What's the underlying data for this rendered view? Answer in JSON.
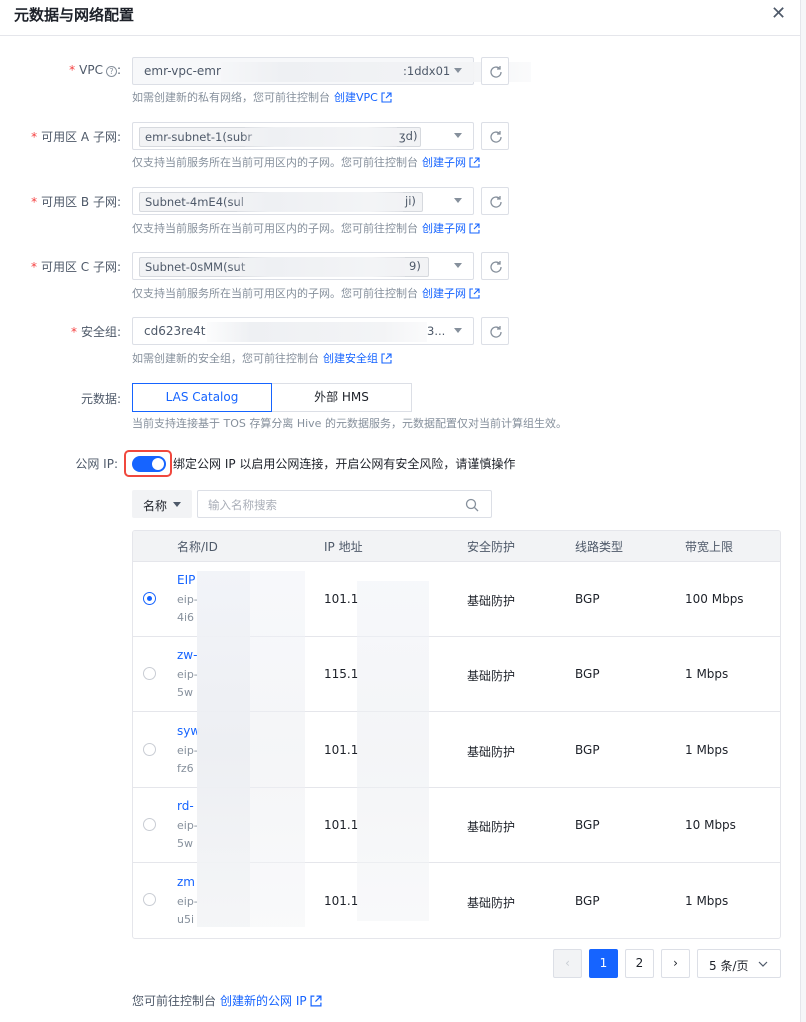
{
  "dialog": {
    "title": "元数据与网络配置",
    "close_glyph": "✕"
  },
  "vpc": {
    "label": "VPC",
    "required_mark": "*",
    "value_prefix": "emr-vpc-emr",
    "value_suffix": ":1ddx01",
    "hint": "如需创建新的私有网络，您可前往控制台",
    "link": "创建VPC"
  },
  "subnet_a": {
    "label": "可用区 A 子网:",
    "required_mark": "*",
    "value_prefix": "emr-subnet-1(subr",
    "value_suffix": "ʒd)",
    "hint": "仅支持当前服务所在当前可用区内的子网。您可前往控制台",
    "link": "创建子网"
  },
  "subnet_b": {
    "label": "可用区 B 子网:",
    "required_mark": "*",
    "value_prefix": "Subnet-4mE4(sul",
    "value_suffix": "ji)",
    "hint": "仅支持当前服务所在当前可用区内的子网。您可前往控制台",
    "link": "创建子网"
  },
  "subnet_c": {
    "label": "可用区 C 子网:",
    "required_mark": "*",
    "value_prefix": "Subnet-0sMM(sut",
    "value_suffix": "9)",
    "hint": "仅支持当前服务所在当前可用区内的子网。您可前往控制台",
    "link": "创建子网"
  },
  "security_group": {
    "label": "安全组:",
    "required_mark": "*",
    "value_prefix": "cd623re4t",
    "value_suffix": "3...",
    "hint": "如需创建新的安全组，您可前往控制台",
    "link": "创建安全组"
  },
  "metadata": {
    "label": "元数据:",
    "options": [
      "LAS Catalog",
      "外部 HMS"
    ],
    "selected": "LAS Catalog",
    "hint": "当前支持连接基于 TOS 存算分离 Hive 的元数据服务，元数据配置仅对当前计算组生效。"
  },
  "public_ip": {
    "label": "公网 IP:",
    "enabled": true,
    "description": "绑定公网 IP 以启用公网连接，开启公网有安全风险，请谨慎操作"
  },
  "filter": {
    "field": "名称",
    "placeholder": "输入名称搜索"
  },
  "table": {
    "columns": [
      "名称/ID",
      "IP 地址",
      "安全防护",
      "线路类型",
      "带宽上限"
    ],
    "rows": [
      {
        "name": "EIP",
        "id_prefix": "eip-",
        "id_line2": "4i6",
        "ip": "101.1",
        "protection": "基础防护",
        "line": "BGP",
        "bandwidth": "100 Mbps",
        "selected": true
      },
      {
        "name": "zw-",
        "id_prefix": "eip-",
        "id_line2": "5w",
        "ip": "115.1",
        "protection": "基础防护",
        "line": "BGP",
        "bandwidth": "1 Mbps",
        "selected": false
      },
      {
        "name": "syw",
        "id_prefix": "eip-",
        "id_line2": "fz6",
        "ip": "101.1",
        "protection": "基础防护",
        "line": "BGP",
        "bandwidth": "1 Mbps",
        "selected": false
      },
      {
        "name": "rd-",
        "id_prefix": "eip-",
        "id_line2": "5w",
        "ip": "101.1",
        "protection": "基础防护",
        "line": "BGP",
        "bandwidth": "10 Mbps",
        "selected": false
      },
      {
        "name": "zm",
        "id_prefix": "eip-",
        "id_line2": "u5i",
        "ip": "101.1",
        "protection": "基础防护",
        "line": "BGP",
        "bandwidth": "1 Mbps",
        "selected": false
      }
    ]
  },
  "pagination": {
    "prev": "‹",
    "pages": [
      "1",
      "2"
    ],
    "current": "1",
    "next": "›",
    "page_size": "5 条/页"
  },
  "footer": {
    "text": "您可前往控制台",
    "link": "创建新的公网 IP"
  },
  "colors": {
    "primary": "#1664ff",
    "required": "#f53f3f",
    "highlight_border": "#f0483e"
  }
}
